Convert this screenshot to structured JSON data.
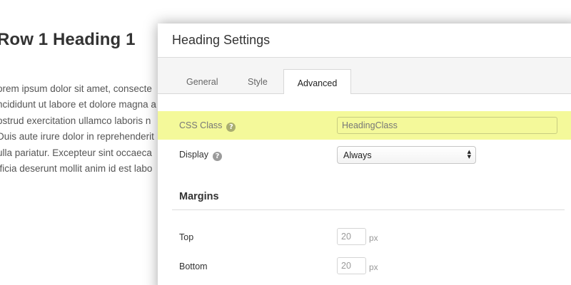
{
  "background": {
    "heading": "Row 1 Heading 1",
    "paragraph_lines": [
      "orem ipsum dolor sit amet, consecte",
      "ncididunt ut labore et dolore magna a",
      "ostrud exercitation ullamco laboris n",
      "Duis aute irure dolor in reprehenderit",
      "ulla pariatur. Excepteur sint occaeca",
      "fficia deserunt mollit anim id est labo"
    ]
  },
  "panel": {
    "title": "Heading Settings",
    "tabs": [
      {
        "label": "General",
        "active": false
      },
      {
        "label": "Style",
        "active": false
      },
      {
        "label": "Advanced",
        "active": true
      }
    ],
    "fields": {
      "css_class": {
        "label": "CSS Class",
        "value": "HeadingClass",
        "help_icon": "question-circle-icon"
      },
      "display": {
        "label": "Display",
        "selected": "Always",
        "help_icon": "question-circle-icon"
      }
    },
    "margins": {
      "title": "Margins",
      "top": {
        "label": "Top",
        "value": "20",
        "unit": "px"
      },
      "bottom": {
        "label": "Bottom",
        "value": "20",
        "unit": "px"
      }
    },
    "colors": {
      "highlight": "#f4f99a",
      "tab_bar": "#f5f5f5"
    }
  }
}
